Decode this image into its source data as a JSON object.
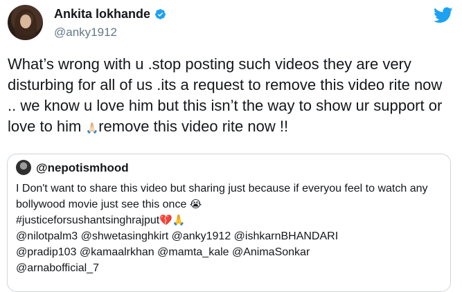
{
  "tweet": {
    "author_name": "Ankita lokhande",
    "author_handle": "@anky1912",
    "text_part1": "What’s wrong with u .stop posting such videos they are very disturbing for all of us .its a request to remove this video rite now .. we know u love him but this isn’t the way to show ur support or love to him ",
    "emoji_pray": "🙏🏻",
    "text_part2": "remove this video rite now !!"
  },
  "quoted_tweet": {
    "handle": "@nepotismhood",
    "line1": "I Don't want to share this video but sharing just because if everyou feel to watch any bollywood movie just see this once ",
    "emoji_cry": "😭",
    "hashtag": "#justiceforsushantsinghrajput",
    "emoji_broken_heart": "💔",
    "emoji_pray": "🙏",
    "mentions_line1": "@nilotpalm3 @shwetasinghkirt @anky1912 @ishkarnBHANDARI",
    "mentions_line2": "@pradip103 @kamaalrkhan @mamta_kale @AnimaSonkar",
    "mentions_line3": "@arnabofficial_7"
  },
  "colors": {
    "twitter_blue": "#1da1f2",
    "secondary_text": "#657786",
    "border": "#ccd6dd"
  },
  "icons": {
    "logo": "twitter-bird-icon",
    "verified": "verified-badge-icon"
  }
}
